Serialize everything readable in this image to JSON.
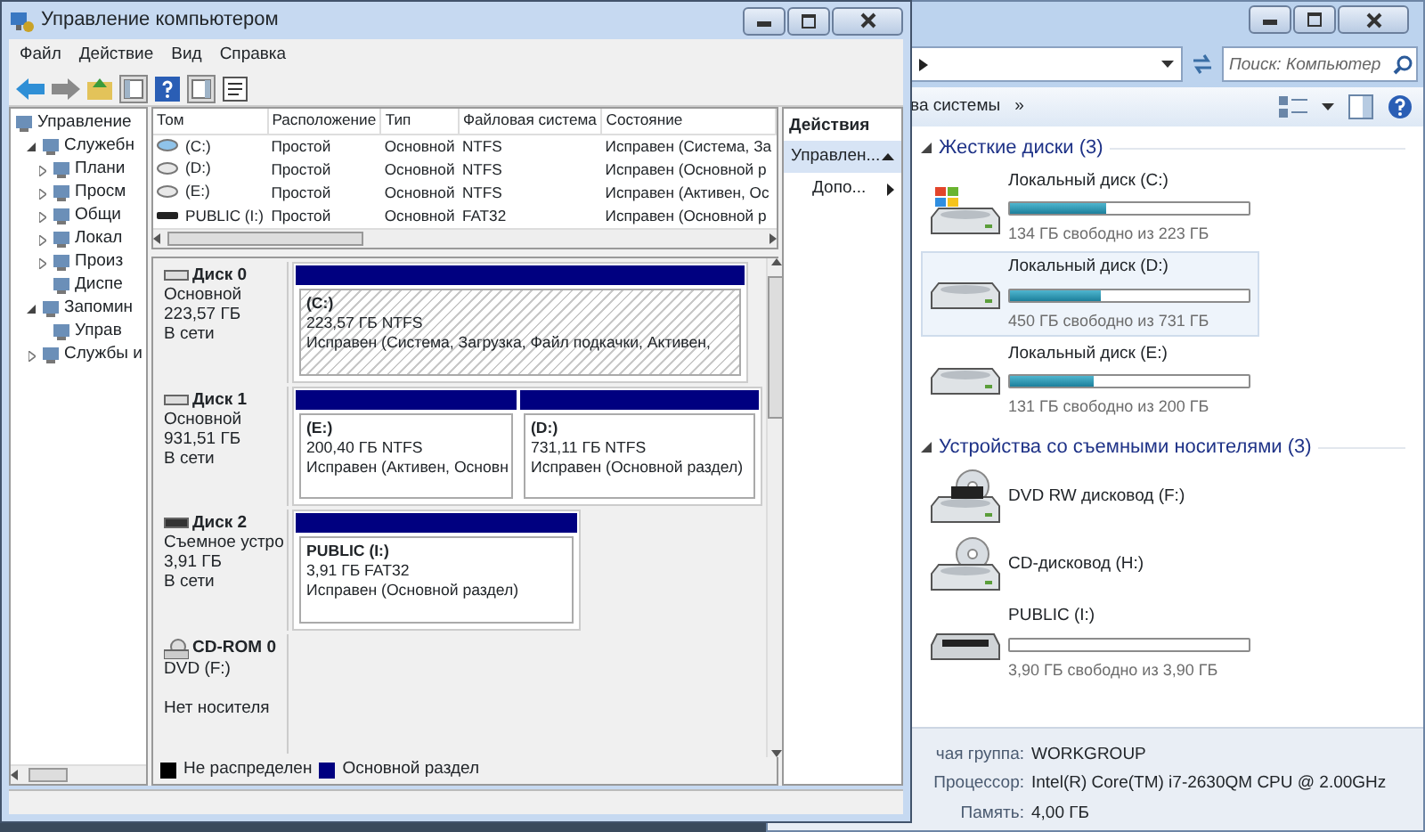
{
  "explorer": {
    "search": {
      "placeholder": "Поиск: Компьютер"
    },
    "toolbar": {
      "cut_item": "ва системы",
      "more": "»"
    },
    "groups": [
      {
        "title": "Жесткие диски (3)",
        "expanded": true,
        "items": [
          {
            "kind": "hdd",
            "name": "Локальный диск (C:)",
            "level": 0.4,
            "free": "134 ГБ свободно из 223 ГБ",
            "selected": false,
            "system": true
          },
          {
            "kind": "hdd",
            "name": "Локальный диск (D:)",
            "level": 0.38,
            "free": "450 ГБ свободно из 731 ГБ",
            "selected": true,
            "system": false
          },
          {
            "kind": "hdd",
            "name": "Локальный диск (E:)",
            "level": 0.35,
            "free": "131 ГБ свободно из 200 ГБ",
            "selected": false,
            "system": false
          }
        ]
      },
      {
        "title": "Устройства со съемными носителями (3)",
        "expanded": true,
        "items": [
          {
            "kind": "dvd",
            "name": "DVD RW дисковод (F:)",
            "selected": false
          },
          {
            "kind": "cd",
            "name": "CD-дисковод (H:)",
            "selected": false
          },
          {
            "kind": "usb",
            "name": "PUBLIC (I:)",
            "level": 0,
            "free": "3,90 ГБ свободно из 3,90 ГБ",
            "selected": false
          }
        ]
      }
    ],
    "details": [
      {
        "label": "чая группа:",
        "value": "WORKGROUP"
      },
      {
        "label": "Процессор:",
        "value": "Intel(R) Core(TM) i7-2630QM CPU @ 2.00GHz"
      },
      {
        "label": "Память:",
        "value": "4,00 ГБ"
      }
    ]
  },
  "window": {
    "title": "Управление компьютером",
    "menu": [
      "Файл",
      "Действие",
      "Вид",
      "Справка"
    ],
    "tree": [
      {
        "label": "Управление",
        "children": [
          {
            "label": "Служебн",
            "expanded": true,
            "children": [
              {
                "label": "Плани",
                "expanded": false
              },
              {
                "label": "Просм",
                "expanded": false
              },
              {
                "label": "Общи",
                "expanded": false
              },
              {
                "label": "Локал",
                "expanded": false
              },
              {
                "label": "Произ",
                "expanded": false
              },
              {
                "label": "Диспе"
              }
            ]
          },
          {
            "label": "Запомин",
            "expanded": true,
            "children": [
              {
                "label": "Управ"
              }
            ]
          },
          {
            "label": "Службы и",
            "expanded": false
          }
        ]
      }
    ],
    "volumes": {
      "columns": [
        "Том",
        "Расположение",
        "Тип",
        "Файловая система",
        "Состояние"
      ],
      "rows": [
        {
          "kind": "system",
          "cells": [
            "(C:)",
            "Простой",
            "Основной",
            "NTFS",
            "Исправен (Система, За"
          ]
        },
        {
          "kind": "disk",
          "cells": [
            "(D:)",
            "Простой",
            "Основной",
            "NTFS",
            "Исправен (Основной р"
          ]
        },
        {
          "kind": "disk",
          "cells": [
            "(E:)",
            "Простой",
            "Основной",
            "NTFS",
            "Исправен (Активен, Ос"
          ]
        },
        {
          "kind": "removable",
          "cells": [
            "PUBLIC (I:)",
            "Простой",
            "Основной",
            "FAT32",
            "Исправен (Основной р"
          ]
        }
      ]
    },
    "disks": [
      {
        "kind": "hdd",
        "name": "Диск 0",
        "lines": [
          "Основной",
          "223,57 ГБ",
          "В сети"
        ],
        "partitions": [
          {
            "kind": "primary",
            "label": "(C:)",
            "size": "223,57 ГБ NTFS",
            "status": "Исправен (Система, Загрузка, Файл подкачки, Активен,",
            "selected": true
          }
        ]
      },
      {
        "kind": "hdd",
        "name": "Диск 1",
        "lines": [
          "Основной",
          "931,51 ГБ",
          "В сети"
        ],
        "partitions": [
          {
            "kind": "primary",
            "label": "(E:)",
            "size": "200,40 ГБ NTFS",
            "status": "Исправен (Активен, Основн",
            "selected": false
          },
          {
            "kind": "primary",
            "label": "(D:)",
            "size": "731,11 ГБ NTFS",
            "status": "Исправен (Основной раздел)",
            "selected": false
          }
        ]
      },
      {
        "kind": "removable",
        "name": "Диск 2",
        "lines": [
          "Съемное устро",
          "3,91 ГБ",
          "В сети"
        ],
        "partitions": [
          {
            "kind": "primary",
            "label": "PUBLIC  (I:)",
            "size": "3,91 ГБ FAT32",
            "status": "Исправен (Основной раздел)",
            "selected": false
          }
        ]
      },
      {
        "kind": "cdrom",
        "name": "CD-ROM 0",
        "lines": [
          "DVD (F:)",
          "Нет носителя"
        ]
      }
    ],
    "legend": [
      {
        "label": "Не распределен",
        "color": "#000000"
      },
      {
        "label": "Основной раздел",
        "color": "#000080"
      }
    ],
    "actions": {
      "title": "Действия",
      "items": [
        {
          "label": "Управлен...",
          "kind": "section",
          "expanded": true
        },
        {
          "label": "Допо...",
          "kind": "submenu"
        }
      ]
    }
  }
}
